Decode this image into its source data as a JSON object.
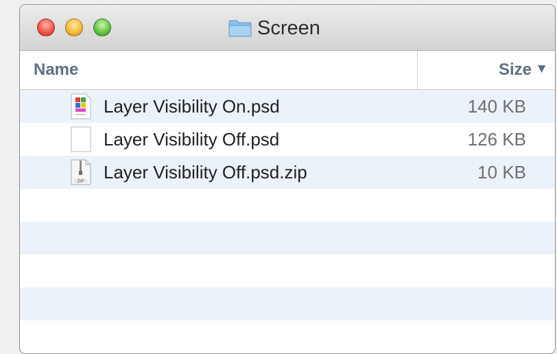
{
  "window": {
    "title": "Screen"
  },
  "columns": {
    "name": "Name",
    "size": "Size",
    "size_sort_indicator": "▼"
  },
  "files": [
    {
      "name": "Layer Visibility On.psd",
      "size": "140 KB",
      "icon": "psd-preview-icon"
    },
    {
      "name": "Layer Visibility Off.psd",
      "size": "126 KB",
      "icon": "blank-document-icon"
    },
    {
      "name": "Layer Visibility Off.psd.zip",
      "size": "10 KB",
      "icon": "zip-archive-icon"
    }
  ],
  "colors": {
    "row_stripe": "#ecf2f9",
    "header_text": "#5e6f84",
    "close": "#f2584a",
    "minimize": "#f7bc3a",
    "zoom": "#6cc447"
  }
}
